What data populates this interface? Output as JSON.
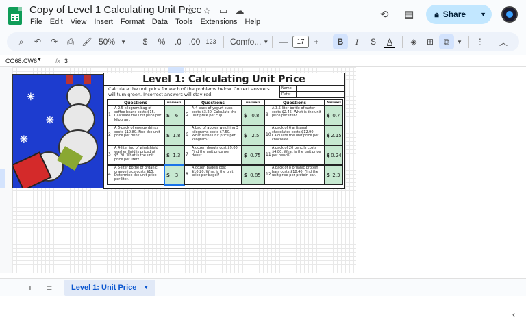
{
  "doc": {
    "title": "Copy of Level 1 Calculating Unit Price",
    "icons": [
      "star-icon",
      "move-to-folder-icon",
      "cloud-status-icon",
      "smiley-icon"
    ]
  },
  "menu": [
    "File",
    "Edit",
    "View",
    "Insert",
    "Format",
    "Data",
    "Tools",
    "Extensions",
    "Help"
  ],
  "share_label": "Share",
  "toolbar": {
    "zoom": "50%",
    "currency": "$",
    "percent": "%",
    "dec_dec": ".0",
    "inc_dec": ".00",
    "format_123": "123",
    "font": "Comfo...",
    "font_size": "17",
    "bold": "B",
    "italic": "I",
    "strike": "S",
    "text_color": "A"
  },
  "formula_bar": {
    "name_box": "CO68:CW6",
    "fx": "fx",
    "value": "3"
  },
  "worksheet": {
    "title": "Level 1: Calculating Unit Price",
    "instructions": "Calculate the unit price for each of the problems below. Correct answers will turn green. Incorrect answers will stay red.",
    "name_label": "Name:",
    "date_label": "Date:",
    "questions_header": "Questions",
    "answers_header": "Answers",
    "items": [
      {
        "n": "1",
        "q": "A 2.5-kilogram bag of coffee beans costs $15. Calculate the unit price per kilogram.",
        "a": "6"
      },
      {
        "n": "2",
        "q": "A 6-pack of energy drinks costs $10.80. Find the unit price per drink.",
        "a": "1.8"
      },
      {
        "n": "3",
        "q": "A 4-liter jug of windshield washer fluid is priced at $5.20. What is the unit price per liter?",
        "a": "1.3"
      },
      {
        "n": "4",
        "q": "A 5-liter bottle of organic orange juice costs $15. Determine the unit price per liter.",
        "a": "3"
      },
      {
        "n": "5",
        "q": "A 4-pack of yogurt cups costs $3.20. Calculate the unit price per cup.",
        "a": "0.8"
      },
      {
        "n": "6",
        "q": "A bag of apples weighing 3 kilograms costs $7.50. What is the unit price per kilogram?",
        "a": "2.5"
      },
      {
        "n": "7",
        "q": "A dozen donuts cost $9.00. Find the unit price per donut.",
        "a": "0.75"
      },
      {
        "n": "8",
        "q": "A dozen bagels cost $10.20. What is the unit price per bagel?",
        "a": "0.85"
      },
      {
        "n": "9",
        "q": "A 3.5-liter bottle of water costs $2.45. What is the unit price per liter?",
        "a": "0.7"
      },
      {
        "n": "10",
        "q": "A pack of 6 artisanal chocolates costs $12.90. Calculate the unit price per chocolate.",
        "a": "2.15"
      },
      {
        "n": "11",
        "q": "A pack of 20 pencils costs $4.80. What is the unit price per pencil?",
        "a": "0.24"
      },
      {
        "n": "12",
        "q": "A pack of 8 organic protein bars costs $18.40. Find the unit price per protein bar.",
        "a": "2.3"
      }
    ],
    "currency_symbol": "$"
  },
  "sheet_tab": "Level 1: Unit Price"
}
